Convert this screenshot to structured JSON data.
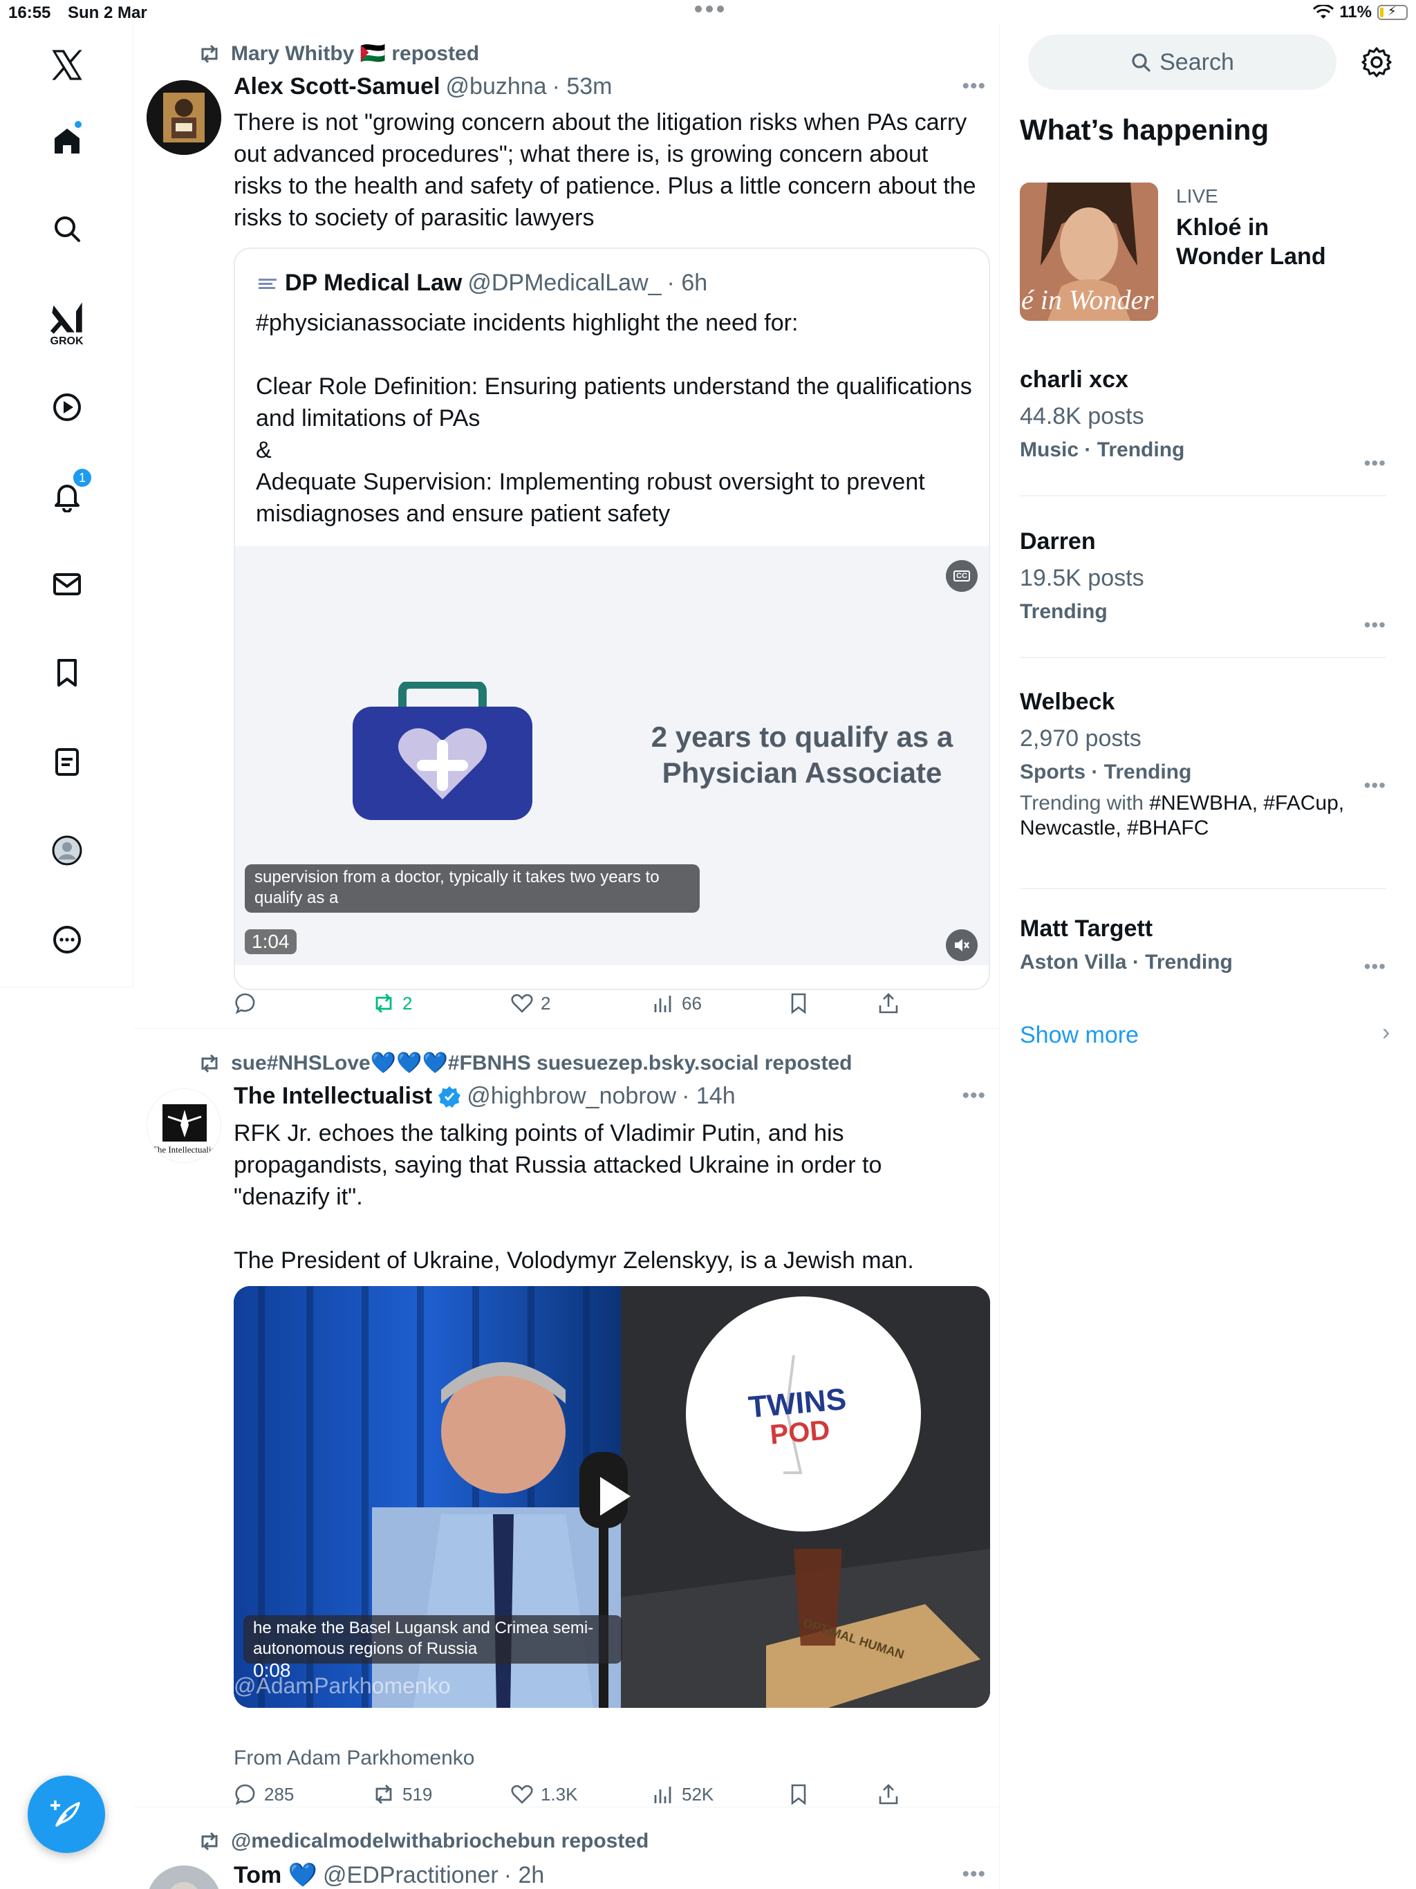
{
  "status_bar": {
    "time": "16:55",
    "date": "Sun 2 Mar",
    "battery": "11%"
  },
  "nav": {
    "grok_label": "GROK",
    "notifications_badge": "1"
  },
  "posts": [
    {
      "repost_by": "Mary Whitby 🇵🇸 reposted",
      "name": "Alex Scott-Samuel",
      "handle": "@buzhna",
      "time": "· 53m",
      "text": "There is not \"growing concern about the litigation risks when PAs carry out advanced procedures\"; what there is, is growing concern about risks to the health and safety of patience. Plus a little concern about the risks to society of parasitic lawyers",
      "quote": {
        "name": "DP Medical Law",
        "handle": "@DPMedicalLaw_",
        "time": "· 6h",
        "text": "#physicianassociate incidents highlight the need for:\n\nClear Role Definition: Ensuring patients understand the qualifications and limitations of PAs\n&\nAdequate Supervision: Implementing robust oversight to prevent misdiagnoses and ensure patient safety",
        "video_title_line1": "2 years to qualify as a",
        "video_title_line2": "Physician Associate",
        "caption": "supervision from a doctor, typically it takes two years to qualify as a",
        "timecode": "1:04",
        "cc_label": "CC"
      },
      "actions": {
        "replies": "",
        "reposts": "2",
        "likes": "2",
        "views": "66"
      }
    },
    {
      "repost_by": "sue#NHSLove💙💙💙#FBNHS suesuezep.bsky.social reposted",
      "name": "The Intellectualist",
      "handle": "@highbrow_nobrow",
      "time": "· 14h",
      "avatar_text": "The Intellectualist",
      "text": "RFK Jr. echoes the talking points of Vladimir Putin, and his propagandists, saying that Russia attacked Ukraine in order to \"denazify it\".\n\nThe President of Ukraine, Volodymyr Zelenskyy, is a Jewish man.",
      "video": {
        "caption": "he make the Basel Lugansk and Crimea semi-autonomous regions of Russia",
        "timecode": "0:08",
        "watermark": "@AdamParkhomenko",
        "sign_line1": "TWINS",
        "sign_line2": "POD",
        "box_text": "OPTIMAL HUMAN"
      },
      "from": "From Adam Parkhomenko",
      "actions": {
        "replies": "285",
        "reposts": "519",
        "likes": "1.3K",
        "views": "52K"
      }
    },
    {
      "repost_by": "@medicalmodelwithabriochebun reposted",
      "name": "Tom 💙",
      "handle": "@EDPractitioner",
      "time": "· 2h"
    }
  ],
  "sidebar": {
    "search_placeholder": "Search",
    "title": "What’s happening",
    "live": {
      "label": "LIVE",
      "title": "Khloé in Wonder Land",
      "image_text": "é in Wonder l"
    },
    "trends": [
      {
        "name": "charli xcx",
        "count": "44.8K posts",
        "category": "Music · Trending"
      },
      {
        "name": "Darren",
        "count": "19.5K posts",
        "category": "Trending"
      },
      {
        "name": "Welbeck",
        "count": "2,970 posts",
        "category": "Sports · Trending",
        "with_label": "Trending with",
        "with_tags": "#NEWBHA, #FACup, Newcastle, #BHAFC"
      },
      {
        "name": "Matt Targett",
        "category": "Aston Villa · Trending"
      }
    ],
    "show_more": "Show more"
  },
  "colors": {
    "accent": "#1d9bf0",
    "repost_green": "#00ba7c",
    "muted": "#536471",
    "nav_blue": "#2b3a9e"
  }
}
